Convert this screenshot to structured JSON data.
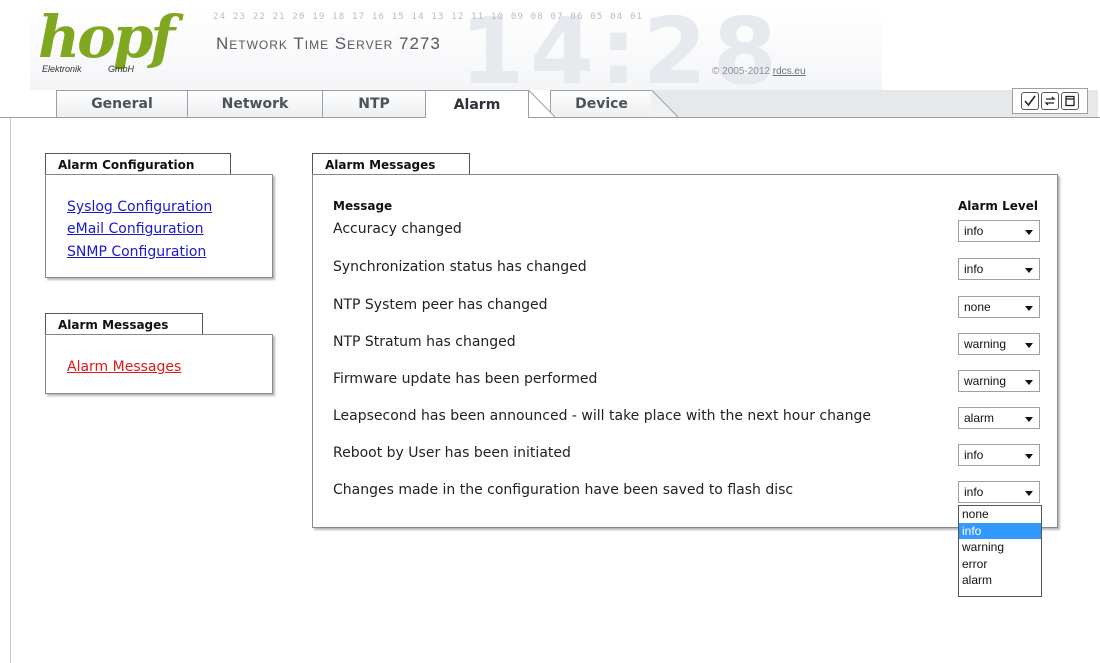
{
  "header": {
    "logo_text": "hopf",
    "logo_sub_left": "Elektronik",
    "logo_sub_right": "GmbH",
    "ruler": "24 23 22 21 20 19 18 17 16 15 14 13 12 11 10 09 08 07 06 05 04 01",
    "product": "Network Time Server 7273",
    "watermark": "14:28",
    "copyright_prefix": "© 2005-2012 ",
    "copyright_link": "rdcs.eu"
  },
  "tabs": [
    {
      "label": "General"
    },
    {
      "label": "Network"
    },
    {
      "label": "NTP"
    },
    {
      "label": "Alarm",
      "active": true
    },
    {
      "label": "Device"
    }
  ],
  "toolbar": {
    "icons": [
      "check-icon",
      "refresh-icon",
      "save-icon"
    ]
  },
  "sidebar": {
    "alarm_config": {
      "title": "Alarm Configuration",
      "links": [
        "Syslog Configuration",
        "eMail Configuration",
        "SNMP Configuration"
      ]
    },
    "alarm_messages": {
      "title": "Alarm Messages",
      "links": [
        "Alarm Messages"
      ]
    }
  },
  "main": {
    "panel_title": "Alarm Messages",
    "col_message": "Message",
    "col_level": "Alarm Level",
    "rows": [
      {
        "message": "Accuracy changed",
        "level": "info"
      },
      {
        "message": "Synchronization status has changed",
        "level": "info"
      },
      {
        "message": "NTP System peer has changed",
        "level": "none"
      },
      {
        "message": "NTP Stratum has changed",
        "level": "warning"
      },
      {
        "message": "Firmware update has been performed",
        "level": "warning"
      },
      {
        "message": "Leapsecond has been announced - will take place with the next hour change",
        "level": "alarm"
      },
      {
        "message": "Reboot by User has been initiated",
        "level": "info"
      },
      {
        "message": "Changes made in the configuration have been saved to flash disc",
        "level": "info"
      }
    ],
    "dropdown_options": [
      "none",
      "info",
      "warning",
      "error",
      "alarm"
    ],
    "dropdown_highlighted": "info"
  },
  "colors": {
    "logo_green": "#7fa820",
    "link_blue": "#1a1acc",
    "link_active_red": "#e01818",
    "highlight_blue": "#3399ff"
  }
}
